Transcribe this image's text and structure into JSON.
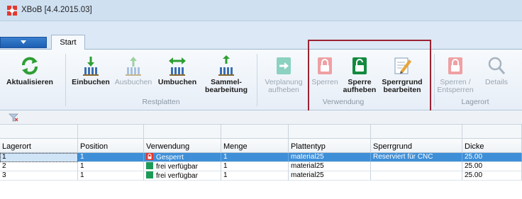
{
  "window": {
    "title": "XBoB [4.4.2015.03]"
  },
  "tabs": {
    "start": "Start"
  },
  "ribbon": {
    "aktualisieren": "Aktualisieren",
    "einbuchen": "Einbuchen",
    "ausbuchen": "Ausbuchen",
    "umbuchen": "Umbuchen",
    "sammel_line1": "Sammel-",
    "sammel_line2": "bearbeitung",
    "restplatten": "Restplatten",
    "verplanung_line1": "Verplanung",
    "verplanung_line2": "aufheben",
    "sperren": "Sperren",
    "sperre_line1": "Sperre",
    "sperre_line2": "aufheben",
    "sperrgrund_line1": "Sperrgrund",
    "sperrgrund_line2": "bearbeiten",
    "verwendung": "Verwendung",
    "entsperren_line1": "Sperren /",
    "entsperren_line2": "Entsperren",
    "details": "Details",
    "lagerort": "Lagerort"
  },
  "table": {
    "headers": [
      "Lagerort",
      "Position",
      "Verwendung",
      "Menge",
      "Plattentyp",
      "Sperrgrund",
      "Dicke"
    ],
    "rows": [
      {
        "lagerort": "1",
        "position": "1",
        "verwendung": "Gesperrt",
        "menge": "1",
        "plattentyp": "material25",
        "sperrgrund": "Reserviert für CNC",
        "dicke": "25.00"
      },
      {
        "lagerort": "2",
        "position": "1",
        "verwendung": "frei verfügbar",
        "menge": "1",
        "plattentyp": "material25",
        "sperrgrund": "",
        "dicke": "25.00"
      },
      {
        "lagerort": "3",
        "position": "1",
        "verwendung": "frei verfügbar",
        "menge": "1",
        "plattentyp": "material25",
        "sperrgrund": "",
        "dicke": "25.00"
      }
    ]
  },
  "colors": {
    "selection": "#3e8fd8",
    "locked": "#e4362f",
    "free": "#1e9a58",
    "highlight_frame": "#9b2333"
  }
}
